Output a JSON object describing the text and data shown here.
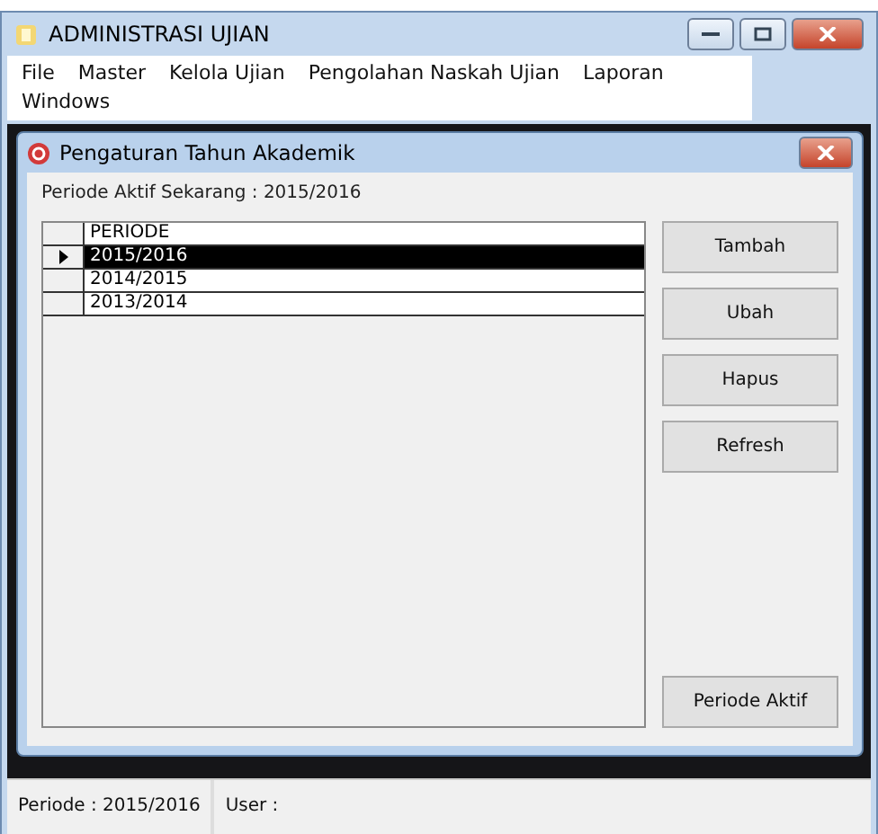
{
  "window": {
    "title": "ADMINISTRASI UJIAN"
  },
  "menu": [
    "File",
    "Master",
    "Kelola Ujian",
    "Pengolahan Naskah Ujian",
    "Laporan",
    "Windows"
  ],
  "dialog": {
    "title": "Pengaturan Tahun Akademik",
    "active_period": "Periode Aktif Sekarang : 2015/2016",
    "table": {
      "columns": [
        "PERIODE"
      ],
      "rows": [
        {
          "periode": "2015/2016",
          "selected": true
        },
        {
          "periode": "2014/2015",
          "selected": false
        },
        {
          "periode": "2013/2014",
          "selected": false
        }
      ]
    },
    "buttons": [
      "Tambah",
      "Ubah",
      "Hapus",
      "Refresh"
    ],
    "bottom_button": "Periode Aktif"
  },
  "status_bar": [
    "Periode : 2015/2016",
    "User :"
  ]
}
